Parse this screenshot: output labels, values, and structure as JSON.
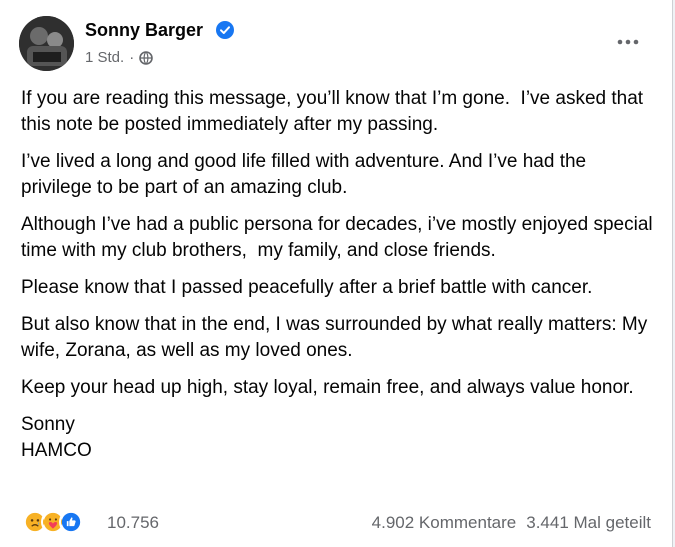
{
  "post": {
    "author": "Sonny Barger",
    "time": "1 Std.",
    "separator": "·",
    "paragraphs": [
      "If you are reading this message, you’ll know that I’m gone.  I’ve asked that this note be posted immediately after my passing.",
      "I’ve lived a long and good life filled with adventure. And I’ve had the privilege to be part of an amazing club.",
      "Although I’ve had a public persona for decades, i’ve mostly enjoyed special  time with my club brothers,  my family, and close friends.",
      "Please know that I passed peacefully after a brief battle with cancer.",
      "But also know that in the end, I was surrounded by what really matters: My wife, Zorana, as well as my loved ones.",
      "Keep your head up high, stay loyal, remain free, and always value honor.",
      "Sonny\nHAMCO"
    ]
  },
  "footer": {
    "reactions": [
      "sad-reaction-icon",
      "care-reaction-icon",
      "like-reaction-icon"
    ],
    "reaction_count": "10.756",
    "comments": "4.902 Kommentare",
    "shares": "3.441 Mal geteilt"
  },
  "colors": {
    "text": "#050505",
    "secondary": "#65676b",
    "verified_blue": "#1877f2"
  }
}
